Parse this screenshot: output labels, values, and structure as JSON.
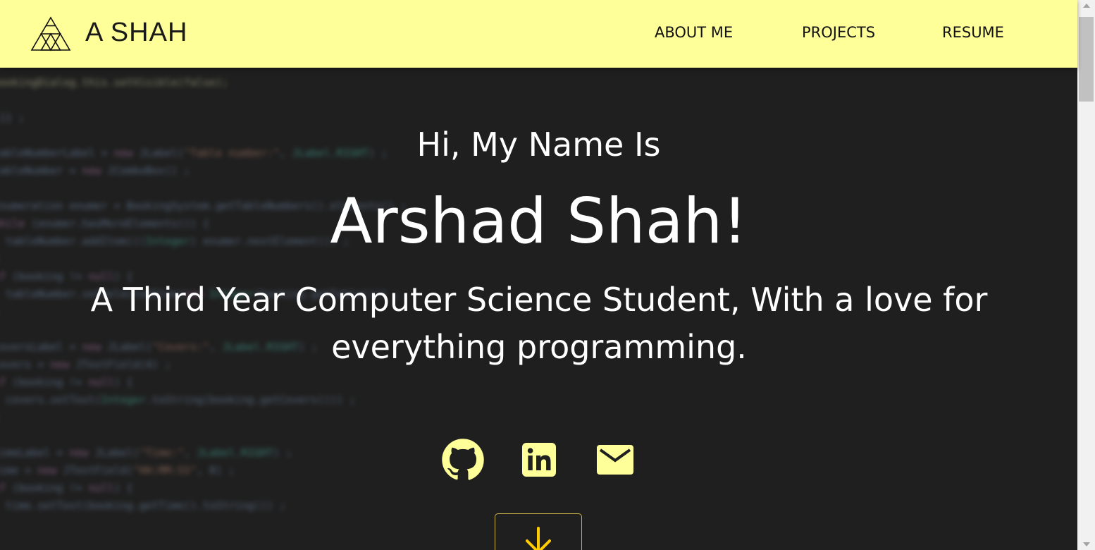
{
  "brand": {
    "name": "A SHAH",
    "logo_icon": "triangle-logo-icon"
  },
  "nav": {
    "items": [
      {
        "label": "ABOUT ME"
      },
      {
        "label": "PROJECTS"
      },
      {
        "label": "RESUME"
      }
    ]
  },
  "hero": {
    "greeting": "Hi, My Name Is",
    "name": "Arshad Shah!",
    "tagline_line1": "A Third Year Computer Science Student, With a love for",
    "tagline_line2": "everything programming."
  },
  "social": [
    {
      "icon": "github-icon"
    },
    {
      "icon": "linkedin-icon"
    },
    {
      "icon": "email-icon"
    }
  ],
  "scroll_button": {
    "icon": "arrow-down-icon"
  },
  "colors": {
    "navbar_bg": "#ffff99",
    "accent": "#ffff99",
    "hero_bg": "#1f1f1f",
    "text": "#ffffff"
  }
}
